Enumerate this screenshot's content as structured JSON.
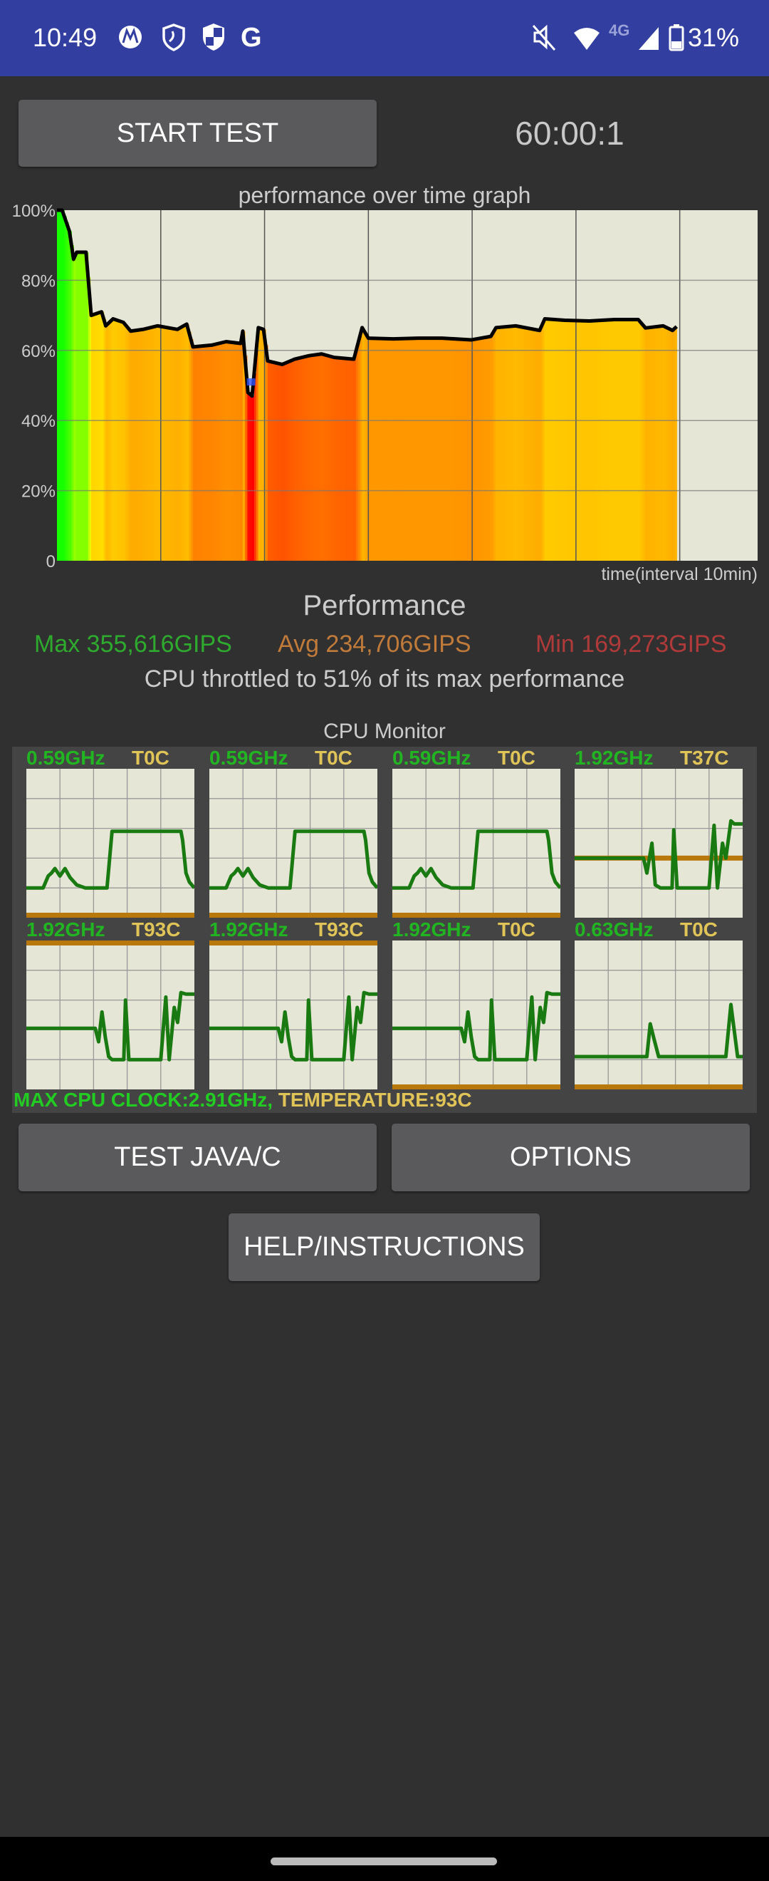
{
  "status_bar": {
    "time": "10:49",
    "left_icons": [
      "motorola-icon",
      "shield-outline-icon",
      "shield-check-icon",
      "google-icon"
    ],
    "right_icons": [
      "mute-icon",
      "wifi-icon",
      "signal-icon",
      "battery-icon"
    ],
    "network": "4G",
    "battery": "31%"
  },
  "header": {
    "start_button": "START TEST",
    "timer": "60:00:1"
  },
  "chart_data": {
    "type": "area",
    "title": "performance over time graph",
    "xlabel": "time(interval 10min)",
    "ylabel": "",
    "x_unit": "minutes",
    "xlim": [
      0,
      67.5
    ],
    "ylim": [
      0,
      100
    ],
    "y_ticks": [
      "0",
      "20%",
      "40%",
      "60%",
      "80%",
      "100%"
    ],
    "grid": true,
    "x": [
      0,
      0.5,
      1.2,
      1.6,
      1.9,
      2.8,
      3.3,
      4.3,
      4.7,
      5.4,
      6.4,
      7.1,
      8.3,
      9.7,
      11.6,
      12.5,
      13.1,
      14.9,
      16.3,
      17.7,
      17.9,
      18.4,
      18.8,
      19.4,
      19.9,
      20.3,
      21.7,
      22.9,
      24.3,
      25.5,
      26.7,
      28.6,
      29.4,
      30,
      32.4,
      34.8,
      37.1,
      39.9,
      41.8,
      42.3,
      44.2,
      46.5,
      47,
      48.9,
      51.3,
      53.7,
      56,
      56.7,
      58.4,
      59.3,
      59.7
    ],
    "y": [
      100,
      100,
      94,
      86,
      88,
      88,
      70,
      71,
      67,
      69,
      68,
      65.5,
      66,
      67,
      66,
      67.5,
      61,
      61.5,
      62.5,
      62,
      65.5,
      48,
      47,
      66.5,
      66,
      57,
      56,
      57.5,
      58.5,
      59,
      58,
      57.5,
      66.5,
      63.5,
      63.3,
      63.5,
      63.5,
      63,
      64,
      66.5,
      67,
      65.7,
      69,
      68.6,
      68.4,
      68.8,
      68.8,
      66.4,
      67,
      65.7,
      66.8
    ],
    "min_marker": {
      "x": 18.7,
      "y": 51,
      "color": "#3355ff"
    },
    "line_color": "#000000",
    "fill": "colored by performance level (green high, red low)"
  },
  "performance": {
    "title": "Performance",
    "max": "Max 355,616GIPS",
    "avg": "Avg 234,706GIPS",
    "min": "Min 169,273GIPS",
    "throttle": "CPU throttled to 51% of its max performance",
    "colors": {
      "max": "#2eaa2e",
      "avg": "#c07a3a",
      "min": "#b03a3a"
    }
  },
  "cpu_monitor": {
    "title": "CPU Monitor",
    "line_color": "#1a7a12",
    "temp_color": "#b8780c",
    "temp_scale_max": 93,
    "cores": [
      {
        "freq": "0.59GHz",
        "temp": "T0C",
        "temp_c": 0,
        "x": [
          0,
          0.1,
          0.13,
          0.15,
          0.17,
          0.2,
          0.23,
          0.26,
          0.3,
          0.35,
          0.48,
          0.51,
          0.6,
          0.8,
          0.92,
          0.93,
          0.95,
          0.97,
          1
        ],
        "y": [
          20,
          20,
          28,
          30,
          33,
          28,
          33,
          27,
          22,
          20,
          20,
          58,
          58,
          58,
          58,
          52,
          30,
          24,
          20
        ]
      },
      {
        "freq": "0.59GHz",
        "temp": "T0C",
        "temp_c": 0,
        "x": [
          0,
          0.1,
          0.13,
          0.15,
          0.17,
          0.2,
          0.23,
          0.26,
          0.3,
          0.35,
          0.48,
          0.51,
          0.6,
          0.8,
          0.92,
          0.93,
          0.95,
          0.97,
          1
        ],
        "y": [
          20,
          20,
          28,
          30,
          33,
          28,
          33,
          27,
          22,
          20,
          20,
          58,
          58,
          58,
          58,
          52,
          30,
          24,
          20
        ]
      },
      {
        "freq": "0.59GHz",
        "temp": "T0C",
        "temp_c": 0,
        "x": [
          0,
          0.1,
          0.13,
          0.15,
          0.17,
          0.2,
          0.23,
          0.26,
          0.3,
          0.35,
          0.48,
          0.51,
          0.6,
          0.8,
          0.92,
          0.93,
          0.95,
          0.97,
          1
        ],
        "y": [
          20,
          20,
          28,
          30,
          33,
          28,
          33,
          27,
          22,
          20,
          20,
          58,
          58,
          58,
          58,
          52,
          30,
          24,
          20
        ]
      },
      {
        "freq": "1.92GHz",
        "temp": "T37C",
        "temp_c": 37,
        "x": [
          0,
          0.41,
          0.43,
          0.46,
          0.48,
          0.51,
          0.58,
          0.59,
          0.61,
          0.8,
          0.83,
          0.85,
          0.88,
          0.9,
          0.93,
          0.95,
          1
        ],
        "y": [
          40,
          40,
          30,
          50,
          22,
          20,
          20,
          59,
          20,
          20,
          62,
          20,
          50,
          40,
          65,
          63,
          63
        ]
      },
      {
        "freq": "1.92GHz",
        "temp": "T93C",
        "temp_c": 93,
        "x": [
          0,
          0.41,
          0.43,
          0.45,
          0.47,
          0.49,
          0.51,
          0.58,
          0.59,
          0.61,
          0.8,
          0.83,
          0.85,
          0.88,
          0.9,
          0.92,
          0.95,
          1
        ],
        "y": [
          41,
          41,
          32,
          52,
          35,
          22,
          20,
          20,
          60,
          20,
          20,
          62,
          20,
          55,
          45,
          65,
          64,
          64
        ]
      },
      {
        "freq": "1.92GHz",
        "temp": "T93C",
        "temp_c": 93,
        "x": [
          0,
          0.41,
          0.43,
          0.45,
          0.47,
          0.49,
          0.51,
          0.58,
          0.59,
          0.61,
          0.8,
          0.83,
          0.85,
          0.88,
          0.9,
          0.92,
          0.95,
          1
        ],
        "y": [
          41,
          41,
          32,
          52,
          35,
          22,
          20,
          20,
          60,
          20,
          20,
          62,
          20,
          55,
          45,
          65,
          64,
          64
        ]
      },
      {
        "freq": "1.92GHz",
        "temp": "T0C",
        "temp_c": 0,
        "x": [
          0,
          0.41,
          0.43,
          0.45,
          0.47,
          0.49,
          0.51,
          0.58,
          0.59,
          0.61,
          0.8,
          0.83,
          0.85,
          0.88,
          0.9,
          0.92,
          0.95,
          1
        ],
        "y": [
          41,
          41,
          32,
          52,
          35,
          22,
          20,
          20,
          60,
          20,
          20,
          62,
          20,
          55,
          45,
          65,
          64,
          64
        ]
      },
      {
        "freq": "0.63GHz",
        "temp": "T0C",
        "temp_c": 0,
        "x": [
          0,
          0.43,
          0.45,
          0.47,
          0.5,
          0.9,
          0.93,
          0.97,
          1
        ],
        "y": [
          22,
          22,
          44,
          35,
          22,
          22,
          57,
          22,
          22
        ]
      }
    ],
    "footer_clock": "MAX CPU CLOCK:2.91GHz,",
    "footer_temp": "TEMPERATURE:93C"
  },
  "buttons": {
    "test_java_c": "TEST JAVA/C",
    "options": "OPTIONS",
    "help": "HELP/INSTRUCTIONS"
  }
}
